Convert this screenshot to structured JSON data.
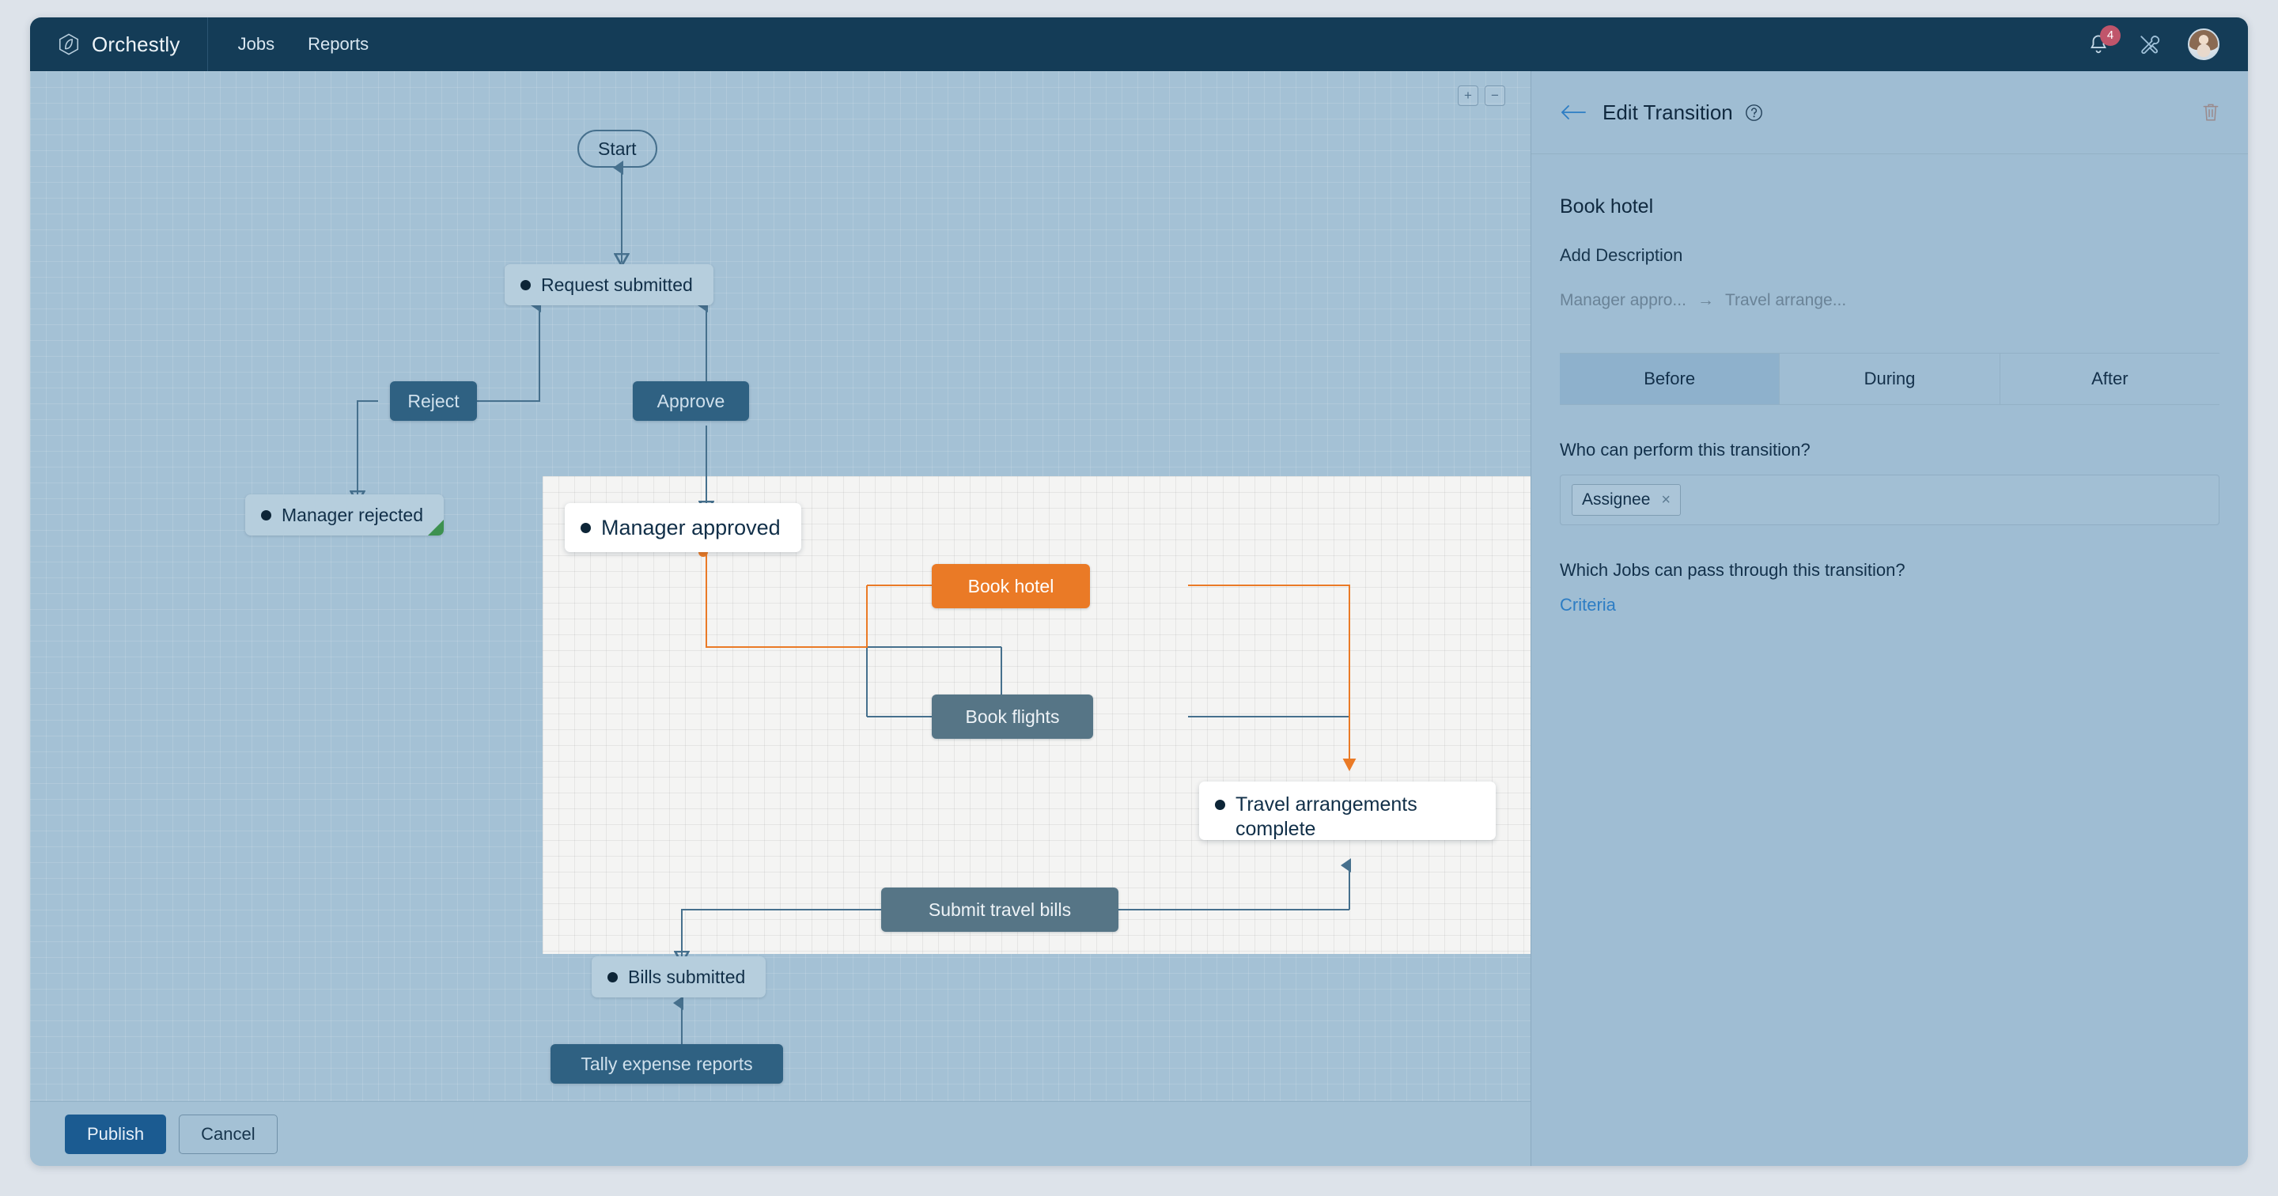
{
  "app": {
    "brand": "Orchestly",
    "brand_logo_icon": "hexagon-leaf-logo",
    "nav": [
      {
        "label": "Jobs",
        "name": "nav-jobs"
      },
      {
        "label": "Reports",
        "name": "nav-reports"
      }
    ],
    "notifications": {
      "icon": "bell-icon",
      "count": "4"
    },
    "tools_icon": "tools-wrench-screwdriver-icon",
    "avatar_icon": "user-avatar"
  },
  "canvas": {
    "zoom_in_label": "+",
    "zoom_out_label": "−",
    "colors": {
      "background": "#a4c1d5",
      "focus_region": "#f4f4f3",
      "state_node": "#b6cedd",
      "state_node_focused": "#ffffff",
      "transition_node": "#2f6182",
      "transition_node_dim": "#567586",
      "transition_selected": "#ea7a26",
      "edge": "#46708d",
      "edge_selected": "#ea7a26",
      "end_marker": "#3d9150"
    },
    "nodes": {
      "start": "Start",
      "request_submitted": "Request submitted",
      "reject": "Reject",
      "approve": "Approve",
      "manager_rejected": "Manager rejected",
      "manager_approved": "Manager approved",
      "book_hotel": "Book hotel",
      "book_flights": "Book flights",
      "travel_complete": "Travel arrangements complete",
      "submit_travel_bills": "Submit travel bills",
      "bills_submitted": "Bills submitted",
      "tally_expense_reports": "Tally expense reports"
    }
  },
  "actions": {
    "publish": "Publish",
    "cancel": "Cancel"
  },
  "panel": {
    "title": "Edit Transition",
    "back_icon": "back-arrow-icon",
    "help_icon": "help-circle-icon",
    "delete_icon": "trash-icon",
    "transition_name": "Book hotel",
    "add_description": "Add Description",
    "crumb_from": "Manager appro...",
    "crumb_arrow": "→",
    "crumb_to": "Travel arrange...",
    "tabs": [
      {
        "label": "Before",
        "active": true
      },
      {
        "label": "During",
        "active": false
      },
      {
        "label": "After",
        "active": false
      }
    ],
    "who_label": "Who can perform this transition?",
    "who_chip": "Assignee",
    "who_chip_remove": "×",
    "which_label": "Which Jobs can pass through this transition?",
    "criteria_link": "Criteria"
  }
}
